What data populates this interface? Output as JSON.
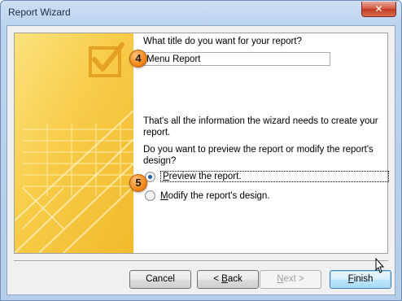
{
  "window": {
    "title": "Report Wizard",
    "close_glyph": "✕",
    "background_ghost_text": "Report Wizard"
  },
  "form": {
    "title_question": "What title do you want for your report?",
    "title_value": "Menu Report",
    "info_line1": "That's all the information the wizard needs to create your",
    "info_line2": "report.",
    "preview_question_line1": "Do you want to preview the report or modify the report's",
    "preview_question_line2": "design?",
    "options": [
      {
        "label": "Preview the report.",
        "selected": true
      },
      {
        "label": "Modify the report's design.",
        "selected": false
      }
    ]
  },
  "callouts": {
    "step_title": "4",
    "step_option": "5",
    "color": "#f28a1e"
  },
  "buttons": {
    "cancel": "Cancel",
    "back": "< Back",
    "next": "Next >",
    "finish": "Finish"
  },
  "icons": {
    "graphic": "report-wizard-checkmark-graphic",
    "cursor": "mouse-pointer-icon"
  },
  "colors": {
    "graphic_yellow": "#f7c842",
    "graphic_light": "#fbe27d",
    "default_button_border": "#3c7fb1"
  }
}
